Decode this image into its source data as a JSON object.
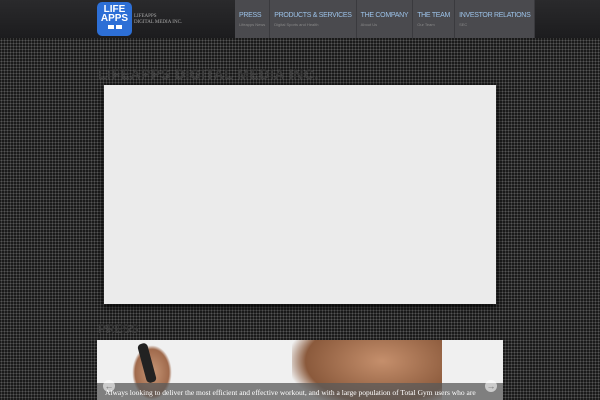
{
  "logo": {
    "line1": "LIFE",
    "line2": "APPS",
    "company_line1": "LIFEAPPS",
    "company_line2": "DIGITAL MEDIA INC."
  },
  "nav": [
    {
      "title": "PRESS",
      "sub": "Lifeapps News"
    },
    {
      "title": "PRODUCTS & SERVICES",
      "sub": "Digital Sports and Health"
    },
    {
      "title": "THE COMPANY",
      "sub": "About Us"
    },
    {
      "title": "THE TEAM",
      "sub": "Our Team"
    },
    {
      "title": "INVESTOR RELATIONS",
      "sub": "SEC"
    }
  ],
  "main": {
    "heading": "LIFEAPPS DIGITAL MEDIA INC.",
    "press_heading": "PRESS"
  },
  "slider": {
    "caption": "Always looking to deliver the most efficient and effective workout, and with a large population of Total Gym users who are",
    "prev": "←",
    "next": "→"
  }
}
